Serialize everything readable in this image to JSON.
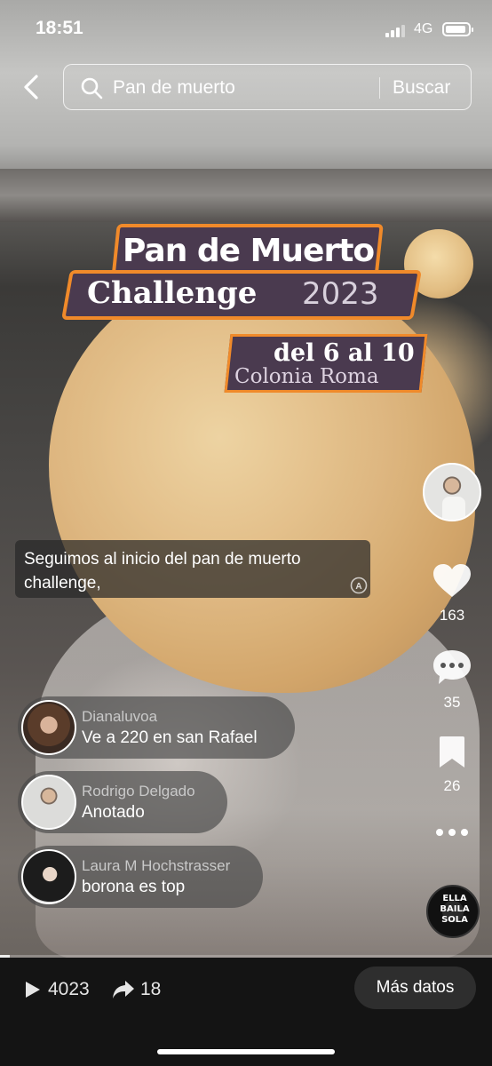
{
  "status_bar": {
    "time": "18:51",
    "network": "4G",
    "icons": [
      "signal-icon",
      "battery-icon"
    ]
  },
  "search": {
    "query": "Pan de muerto",
    "button_label": "Buscar",
    "icons": [
      "back-arrow-icon",
      "search-icon"
    ]
  },
  "video_overlay": {
    "title": "Pan de Muerto",
    "subtitle": "Challenge",
    "year": "2023",
    "dates": "del  6 al 10",
    "location": "Colonia Roma"
  },
  "caption": {
    "text": "Seguimos al inicio del pan de muerto challenge,",
    "icons": [
      "translate-icon"
    ]
  },
  "actions": {
    "likes": "163",
    "comments": "35",
    "saves": "26",
    "sound_label": "ELLA BAILA SOLA",
    "icons": [
      "heart-icon",
      "comment-icon",
      "bookmark-icon",
      "more-dots-icon"
    ]
  },
  "comments": [
    {
      "user": "Dianaluvoa",
      "text": "Ve a 220 en san Rafael"
    },
    {
      "user": "Rodrigo Delgado",
      "text": "Anotado"
    },
    {
      "user": "Laura M Hochstrasser",
      "text": "borona es top"
    }
  ],
  "playback": {
    "progress": 0.02
  },
  "bottom_bar": {
    "views": "4023",
    "shares": "18",
    "more_info_label": "Más datos",
    "icons": [
      "play-icon",
      "share-arrow-icon"
    ]
  },
  "colors": {
    "banner_border": "#f08a2a",
    "banner_fill": "#4a3a4f",
    "bottom_bar": "#141414"
  }
}
